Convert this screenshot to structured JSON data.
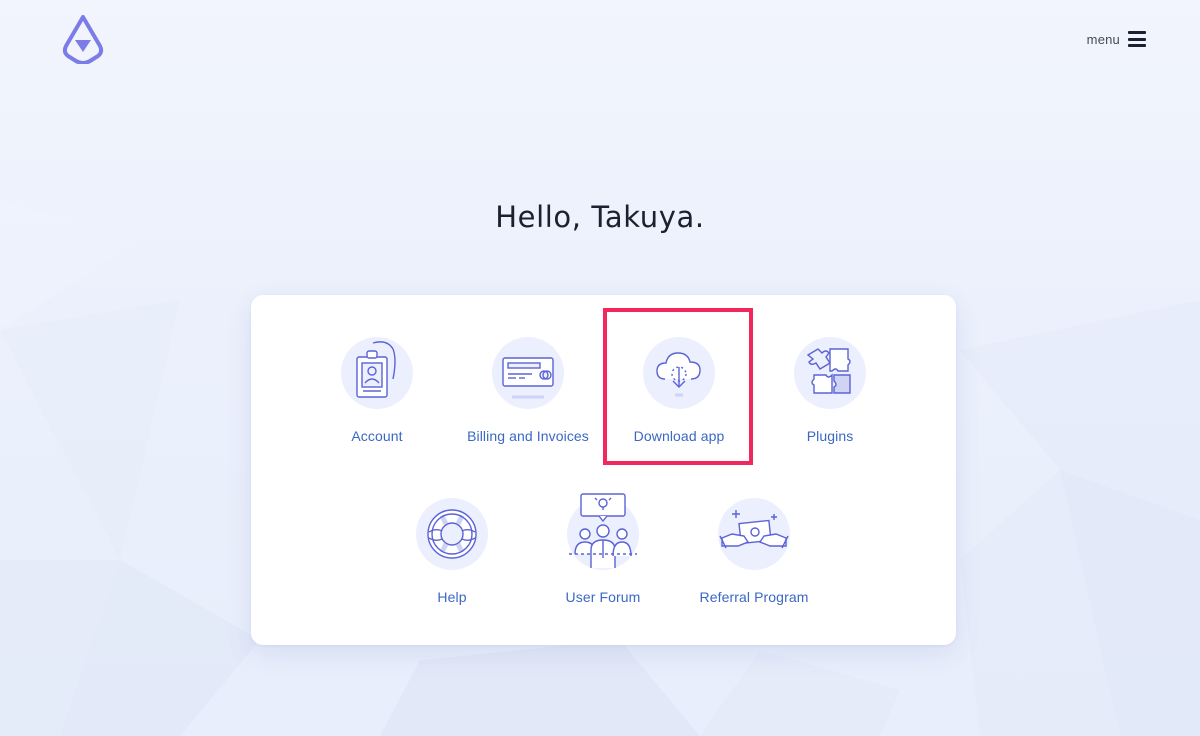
{
  "header": {
    "logo_icon": "triangle-badge-logo",
    "menu_label": "menu",
    "menu_icon": "hamburger-icon"
  },
  "greeting": "Hello, Takuya.",
  "tiles": [
    {
      "label": "Account",
      "icon": "id-badge-icon"
    },
    {
      "label": "Billing and Invoices",
      "icon": "credit-card-icon"
    },
    {
      "label": "Download app",
      "icon": "cloud-download-icon"
    },
    {
      "label": "Plugins",
      "icon": "puzzle-icon"
    },
    {
      "label": "Help",
      "icon": "lifebuoy-icon"
    },
    {
      "label": "User Forum",
      "icon": "users-forum-icon"
    },
    {
      "label": "Referral Program",
      "icon": "hands-money-icon"
    }
  ],
  "colors": {
    "accent": "#3a68c4",
    "icon_stroke": "#5b63d6",
    "icon_fill": "#eceffd",
    "highlight": "#f2275e",
    "logo": "#7b7ce8"
  }
}
